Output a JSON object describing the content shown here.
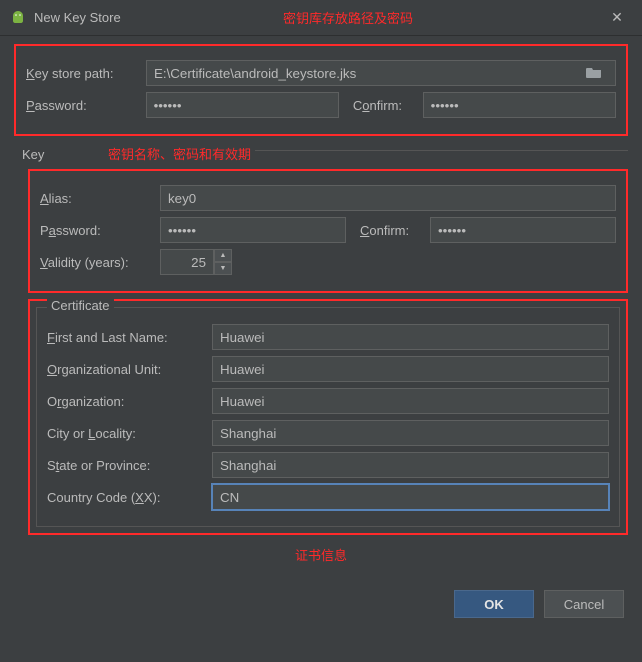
{
  "window": {
    "title": "New Key Store",
    "annotation_top": "密钥库存放路径及密码",
    "close": "✕"
  },
  "keystore": {
    "path_label": "Key store path:",
    "path_value": "E:\\Certificate\\android_keystore.jks",
    "password_label": "Password:",
    "password_value": "••••••",
    "confirm_label": "Confirm:",
    "confirm_value": "••••••"
  },
  "key": {
    "section_label": "Key",
    "annotation": "密钥名称、密码和有效期",
    "alias_label": "Alias:",
    "alias_value": "key0",
    "password_label": "Password:",
    "password_value": "••••••",
    "confirm_label": "Confirm:",
    "confirm_value": "••••••",
    "validity_label": "Validity (years):",
    "validity_value": "25"
  },
  "cert": {
    "legend": "Certificate",
    "first_last_name_label": "First and Last Name:",
    "first_last_name_value": "Huawei",
    "org_unit_label": "Organizational Unit:",
    "org_unit_value": "Huawei",
    "org_label": "Organization:",
    "org_value": "Huawei",
    "city_label": "City or Locality:",
    "city_value": "Shanghai",
    "state_label": "State or Province:",
    "state_value": "Shanghai",
    "country_label": "Country Code (XX):",
    "country_value": "CN"
  },
  "footer": {
    "annotation": "证书信息",
    "ok": "OK",
    "cancel": "Cancel"
  }
}
